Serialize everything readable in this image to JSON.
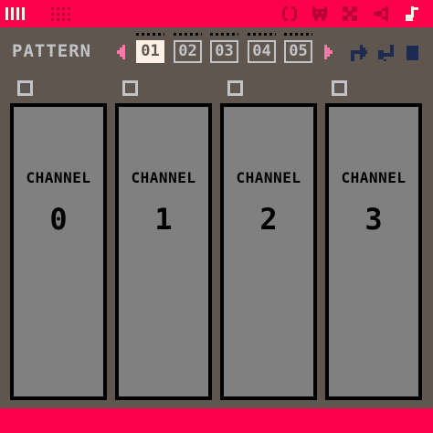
{
  "colors": {
    "accent": "#ff004d",
    "background": "#5f574f",
    "light": "#c2c3c7",
    "channel_bg": "#808080",
    "highlight": "#fff1e8",
    "tool_icon": "#1d2b53",
    "arrow": "#ff77a8"
  },
  "top_icons": [
    "code-editor-icon",
    "sprite-editor-icon",
    "map-editor-icon",
    "sfx-editor-icon",
    "music-editor-icon"
  ],
  "pattern": {
    "label": "PATTERN",
    "buttons": [
      "01",
      "02",
      "03",
      "04",
      "05"
    ],
    "selected": "01"
  },
  "channels": [
    {
      "label": "CHANNEL",
      "number": "0"
    },
    {
      "label": "CHANNEL",
      "number": "1"
    },
    {
      "label": "CHANNEL",
      "number": "2"
    },
    {
      "label": "CHANNEL",
      "number": "3"
    }
  ]
}
